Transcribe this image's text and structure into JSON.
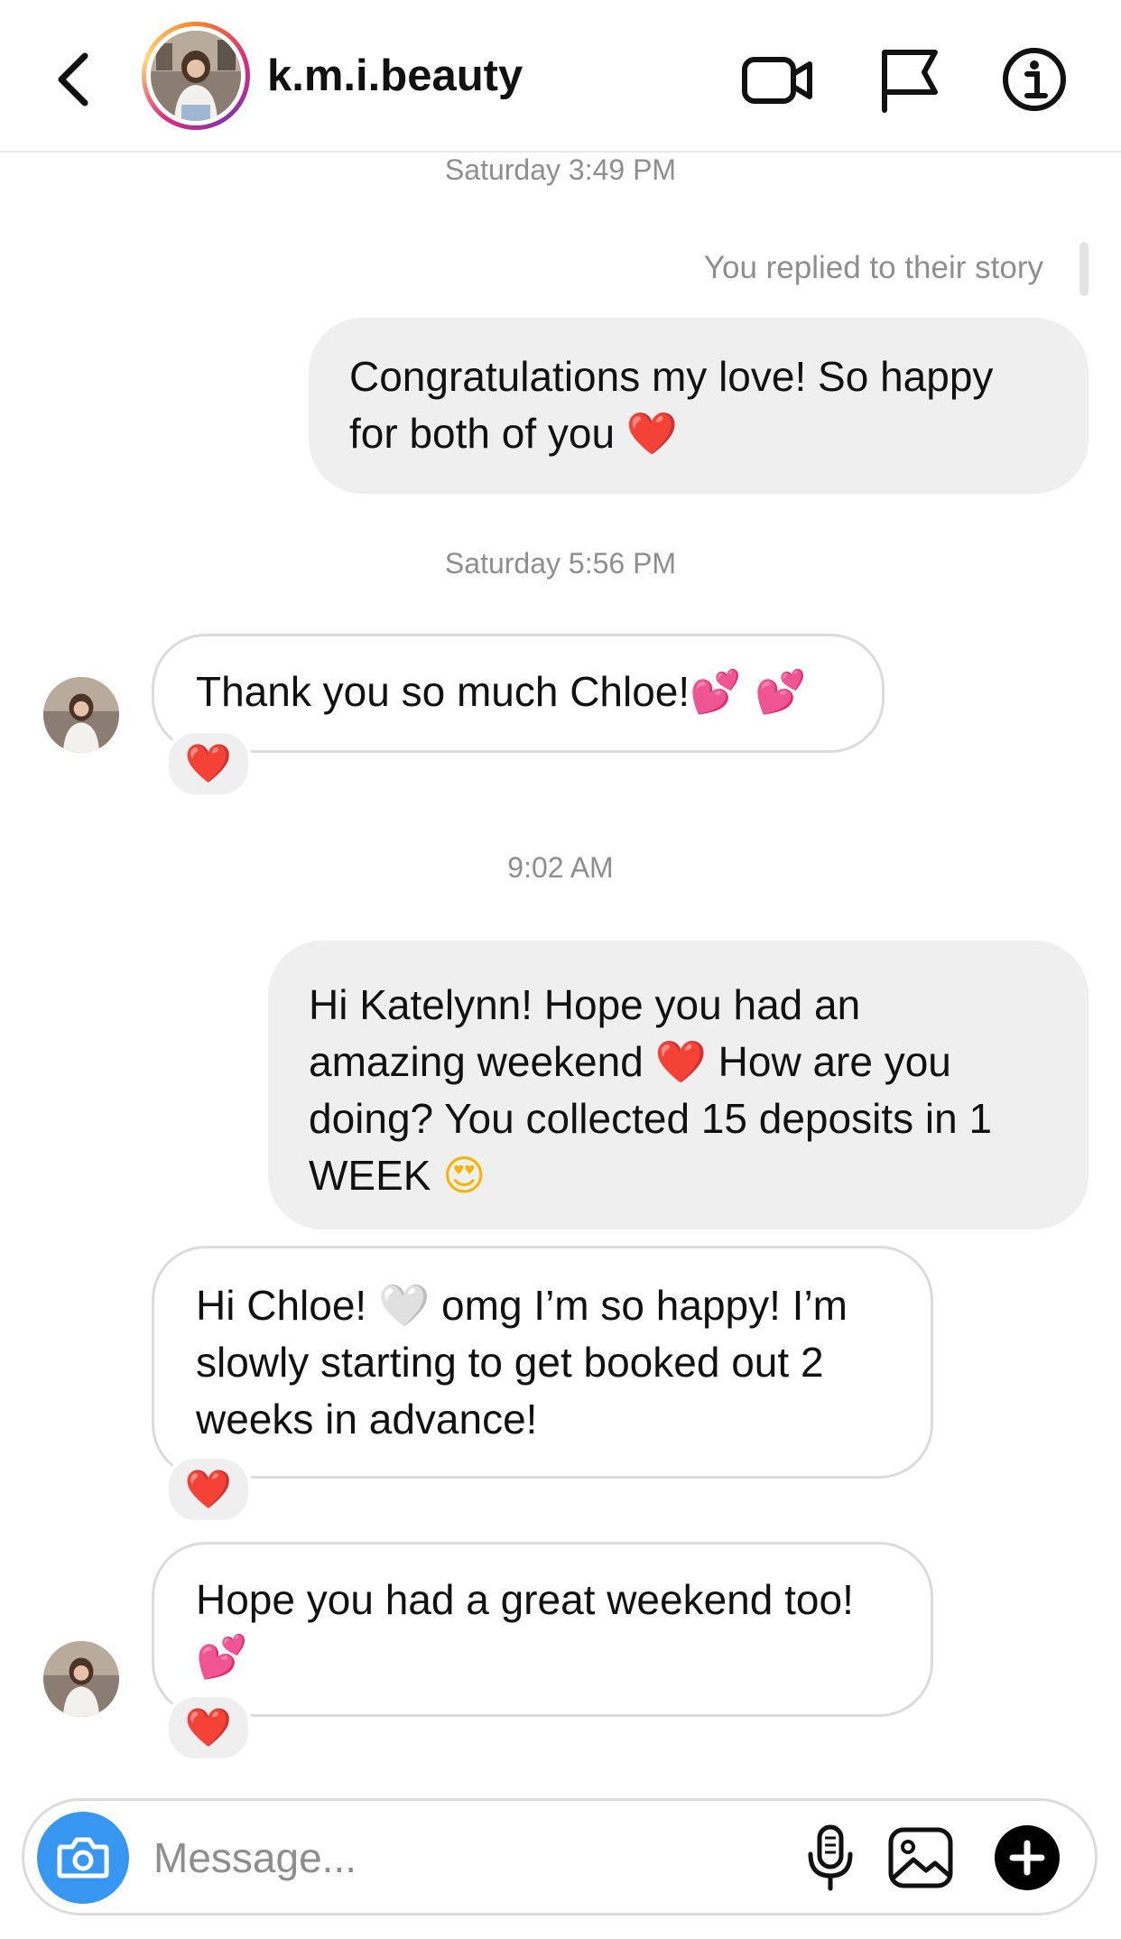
{
  "header": {
    "username": "k.m.i.beauty",
    "icons": [
      "back-chevron-icon",
      "video-call-icon",
      "flag-icon",
      "info-icon"
    ]
  },
  "messages": {
    "ts1": "Saturday 3:49 PM",
    "reply_note": "You replied to their story",
    "m1": {
      "text": "Congratulations my love! So happy",
      "text2": "for both of you",
      "emoji": "❤️"
    },
    "ts2": "Saturday 5:56 PM",
    "m2": {
      "text": "Thank you so much Chloe!",
      "emoji": "💕 💕",
      "reaction": "❤️"
    },
    "ts3": "9:02 AM",
    "m3": {
      "line1": "Hi Katelynn! Hope you had an",
      "line2a": "amazing weekend",
      "emoji1": "❤️",
      "line2b": "How are you",
      "line3": "doing? You collected 15 deposits in 1",
      "line4": "WEEK",
      "emoji2": "😍"
    },
    "m4": {
      "line1a": "Hi Chloe!",
      "emoji": "🤍",
      "line1b": "omg I’m so happy! I’m",
      "line2": "slowly starting to get booked out 2",
      "line3": "weeks in advance!",
      "reaction": "❤️"
    },
    "m5": {
      "line1": "Hope you had a great weekend too!",
      "emoji": "💕",
      "reaction": "❤️"
    }
  },
  "composer": {
    "placeholder": "Message...",
    "icons": [
      "camera-icon",
      "microphone-icon",
      "gallery-icon",
      "plus-icon"
    ],
    "camera_color": "#3797f0"
  },
  "colors": {
    "outgoing_bubble": "#efefef",
    "incoming_border": "#dbdbdb",
    "meta_text": "#8e8e8e",
    "heart": "#e0112b"
  }
}
